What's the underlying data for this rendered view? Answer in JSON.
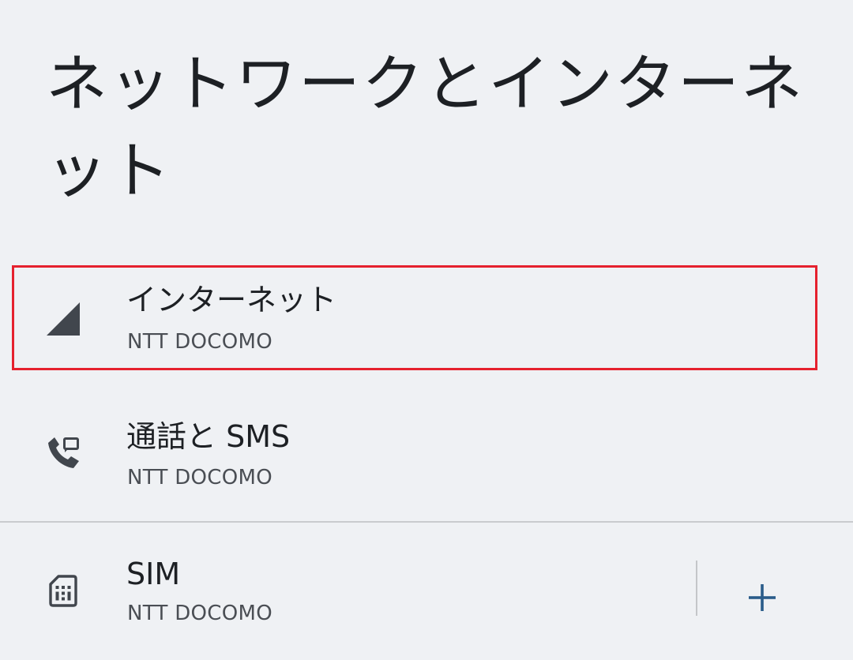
{
  "page": {
    "title": "ネットワークとインターネット"
  },
  "items": [
    {
      "id": "internet",
      "icon": "cellular-signal-icon",
      "title": "インターネット",
      "summary": "NTT DOCOMO",
      "highlighted": true
    },
    {
      "id": "calls-sms",
      "icon": "phone-message-icon",
      "title": "通話と SMS",
      "summary": "NTT DOCOMO"
    },
    {
      "id": "sim",
      "icon": "sim-card-icon",
      "title": "SIM",
      "summary": "NTT DOCOMO",
      "action_icon": "add-icon"
    }
  ],
  "colors": {
    "background": "#eff1f4",
    "text_primary": "#1d2024",
    "text_secondary": "#4a4e54",
    "icon": "#41464d",
    "accent": "#2a5c8a",
    "highlight": "#e5212e"
  }
}
